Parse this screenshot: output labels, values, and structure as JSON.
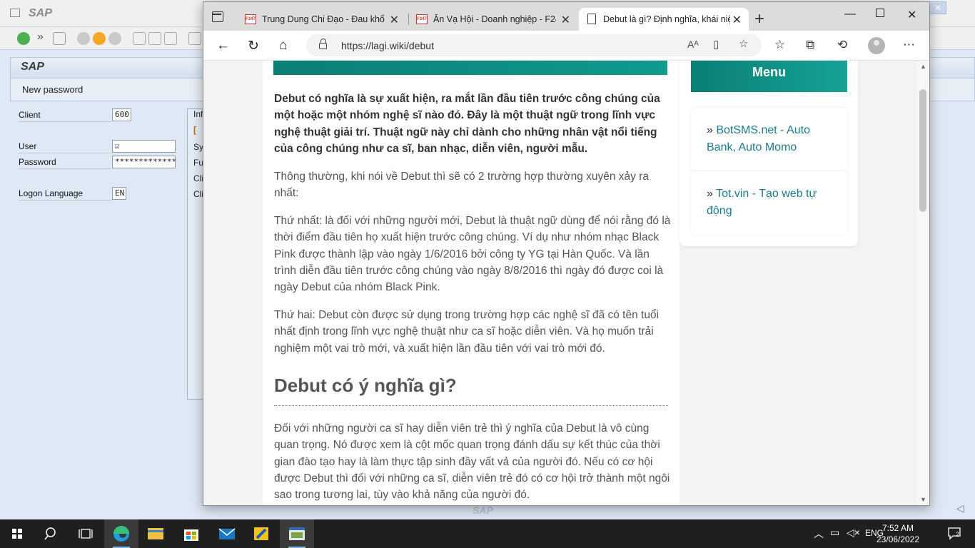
{
  "sap": {
    "title": "SAP",
    "header_title": "SAP",
    "subheader": "New password",
    "client_label": "Client",
    "client_value": "600",
    "user_label": "User",
    "user_value": "☑",
    "password_label": "Password",
    "password_value": "*************",
    "logon_language_label": "Logon Language",
    "logon_language_value": "EN",
    "info_tab": "Inf",
    "info_lines": [
      "[",
      "Sy",
      "Fu",
      "Cli",
      "Cli"
    ],
    "bottom_logo": "SAP"
  },
  "browser": {
    "tabs": [
      {
        "favicon_text": "F247",
        "title": "Trung Dung Chi Đạo - Đau khổ v"
      },
      {
        "favicon_text": "F247",
        "title": "Ăn Vạ Hội - Doanh nghiệp - F24"
      },
      {
        "favicon_text": "",
        "title": "Debut là gì? Định nghĩa, khái niệ"
      }
    ],
    "url": "https://lagi.wiki/debut"
  },
  "article": {
    "intro": "Debut có nghĩa là sự xuất hiện, ra mắt lần đầu tiên trước công chúng của một hoặc một nhóm nghệ sĩ nào đó. Đây là một thuật ngữ trong lĩnh vực nghệ thuật giải trí. Thuật ngữ này chỉ dành cho những nhân vật nổi tiếng của công chúng như ca sĩ, ban nhạc, diễn viên, người mẫu.",
    "p1": "Thông thường, khi nói về Debut thì sẽ có 2 trường hợp thường xuyên xảy ra nhất:",
    "p2": "Thứ nhất: là đối với những người mới, Debut là thuật ngữ dùng để nói rằng đó là thời điểm đầu tiên họ xuất hiện trước công chúng. Ví dụ như nhóm nhạc Black Pink được thành lập vào ngày 1/6/2016 bởi công ty YG tại Hàn Quốc. Và lần trình diễn đầu tiên trước công chúng vào ngày 8/8/2016 thì ngày đó được coi là ngày Debut của nhóm Black Pink.",
    "p3": "Thứ hai: Debut còn được sử dụng trong trường hợp các nghệ sĩ đã có tên tuổi nhất định trong lĩnh vực nghệ thuật như ca sĩ hoặc diễn viên. Và họ muốn trải nghiệm một vai trò mới, và xuất hiện lần đầu tiên với vai trò mới đó.",
    "heading": "Debut có ý nghĩa gì?",
    "p4": "Đối với những người ca sĩ hay diễn viên trẻ thì ý nghĩa của Debut là vô cùng quan trọng. Nó được xem là cột mốc quan trọng đánh dấu sự kết thúc của thời gian đào tạo hay là làm thực tập sinh đầy vất vả của người đó. Nếu có cơ hội được Debut thì đối với những ca sĩ, diễn viên trẻ đó có cơ hội trở thành một ngôi sao trong tương lai, tùy vào khả năng của người đó."
  },
  "sidebar": {
    "menu_title": "Menu",
    "links": [
      {
        "prefix": "» ",
        "text": "BotSMS.net - Auto Bank, Auto Momo"
      },
      {
        "prefix": "» ",
        "text": "Tot.vin - Tạo web tự động"
      }
    ]
  },
  "taskbar": {
    "language": "ENG",
    "time": "7:52 AM",
    "date": "23/06/2022",
    "notification_count": "2"
  },
  "colors": {
    "teal": "#0b7f74",
    "link": "#1a7c8c",
    "taskbar": "#1f1f1f"
  }
}
